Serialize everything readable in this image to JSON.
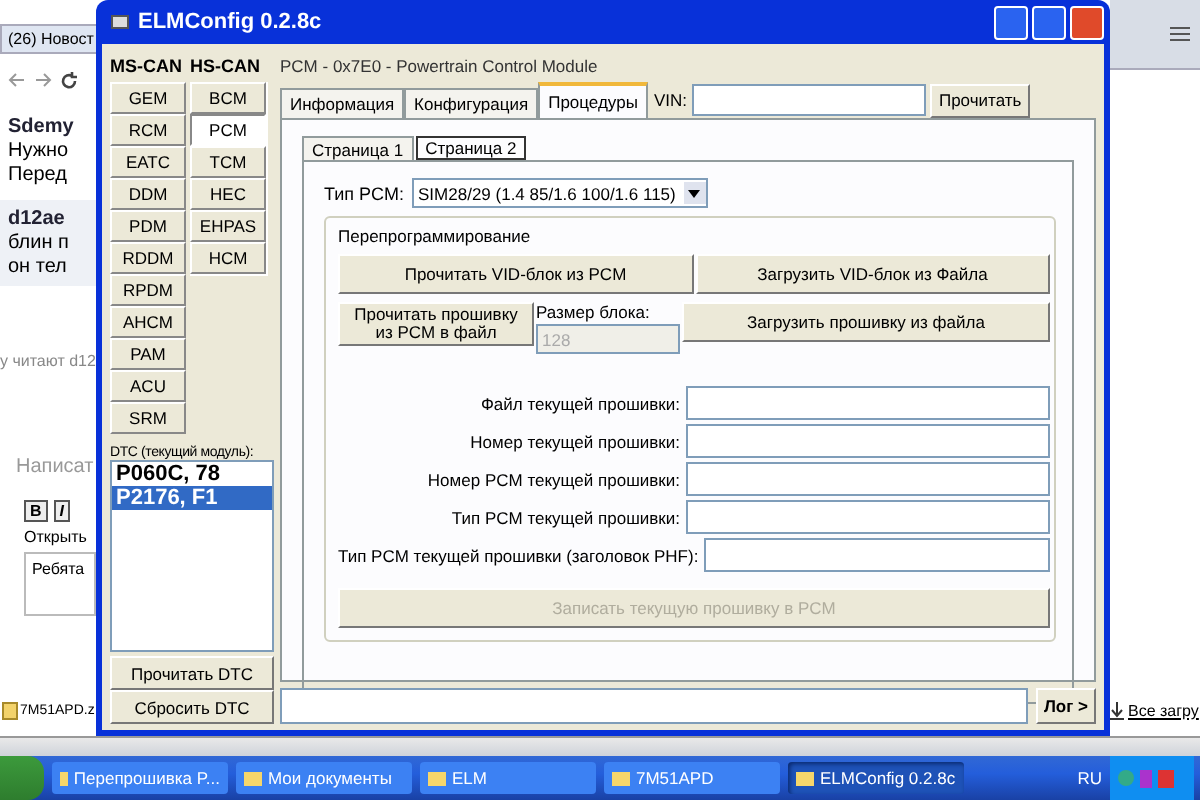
{
  "browser": {
    "tab": "(26) Новост",
    "posts": [
      {
        "author": "Sdemy",
        "lines": [
          "Нужно",
          "Перед"
        ]
      },
      {
        "author": "d12ae",
        "lines": [
          "блин п",
          "он тел"
        ]
      }
    ],
    "reading_note": "у читают d12",
    "reply_heading": "Написат",
    "format_buttons": [
      "B",
      "I"
    ],
    "open_link": "Открыть",
    "reply_text": "Ребята",
    "download_file": "7M51APD.z",
    "downloads_link": "Все загру"
  },
  "window": {
    "title": "ELMConfig 0.2.8c"
  },
  "modules": {
    "ms_can": {
      "heading": "MS-CAN",
      "items": [
        {
          "label": "GEM",
          "selected": false
        },
        {
          "label": "RCM",
          "selected": false
        },
        {
          "label": "EATC",
          "selected": false
        },
        {
          "label": "DDM",
          "selected": false
        },
        {
          "label": "PDM",
          "selected": false
        },
        {
          "label": "RDDM",
          "selected": false
        },
        {
          "label": "RPDM",
          "selected": false
        },
        {
          "label": "AHCM",
          "selected": false
        },
        {
          "label": "PAM",
          "selected": false
        },
        {
          "label": "ACU",
          "selected": false
        },
        {
          "label": "SRM",
          "selected": false
        }
      ]
    },
    "hs_can": {
      "heading": "HS-CAN",
      "items": [
        {
          "label": "BCM",
          "selected": false
        },
        {
          "label": "PCM",
          "selected": true
        },
        {
          "label": "TCM",
          "selected": false
        },
        {
          "label": "HEC",
          "selected": false
        },
        {
          "label": "EHPAS",
          "selected": false
        },
        {
          "label": "HCM",
          "selected": false
        }
      ]
    }
  },
  "dtc": {
    "heading": "DTC (текущий модуль):",
    "codes": [
      {
        "code": "P060C, 78",
        "selected": false
      },
      {
        "code": "P2176, F1",
        "selected": true
      }
    ],
    "buttons": [
      "Прочитать DTC",
      "Сбросить DTC"
    ]
  },
  "module_title": "PCM - 0x7E0 - Powertrain Control Module",
  "tabs": [
    {
      "label": "Информация",
      "selected": false
    },
    {
      "label": "Конфигурация",
      "selected": false
    },
    {
      "label": "Процедуры",
      "selected": true
    }
  ],
  "vin": {
    "label": "VIN:",
    "button": "Прочитать"
  },
  "pages": [
    {
      "label": "Страница 1",
      "selected": false
    },
    {
      "label": "Страница 2",
      "selected": true
    }
  ],
  "pcm_type": {
    "label": "Тип PCM:",
    "value": "SIM28/29 (1.4 85/1.6 100/1.6 115)"
  },
  "reprogramming": {
    "title": "Перепрограммирование",
    "read_vid_button": "Прочитать VID-блок из PCM",
    "load_vid_button": "Загрузить VID-блок из Файла",
    "read_firmware_button": "Прочитать прошивку из PCM в файл",
    "block_size": {
      "label": "Размер блока:",
      "value": "128",
      "disabled": true
    },
    "load_firmware_button": "Загрузить прошивку из файла",
    "fields": [
      {
        "label": "Файл текущей прошивки:"
      },
      {
        "label": "Номер текущей прошивки:"
      },
      {
        "label": "Номер PCM текущей прошивки:"
      },
      {
        "label": "Тип PCM текущей прошивки:"
      },
      {
        "label": "Тип PCM текущей прошивки (заголовок PHF):"
      }
    ],
    "write_button": {
      "label": "Записать текущую прошивку в PCM",
      "disabled": true
    }
  },
  "status_bar": {
    "log_button": "Лог >"
  },
  "taskbar": {
    "items": [
      {
        "label": "Перепрошивка P...",
        "selected": false
      },
      {
        "label": "Мои документы",
        "selected": false
      },
      {
        "label": "ELM",
        "selected": false
      },
      {
        "label": "7M51APD",
        "selected": false
      },
      {
        "label": "ELMConfig 0.2.8c",
        "selected": true
      }
    ],
    "language": "RU"
  }
}
